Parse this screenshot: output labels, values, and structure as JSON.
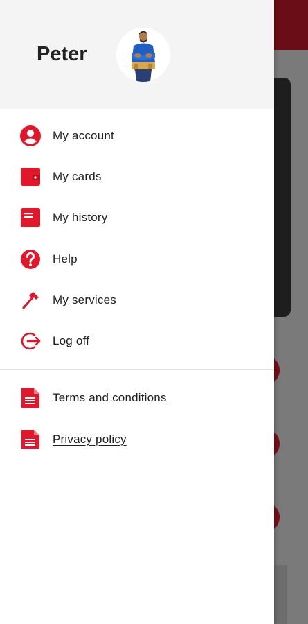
{
  "colors": {
    "accent": "#e3172b",
    "text": "#222222",
    "header_bg": "#f4f4f4",
    "overlay": "#7a7a7a"
  },
  "user": {
    "name": "Peter",
    "avatar_icon": "worker-avatar"
  },
  "menu": [
    {
      "label": "My account",
      "icon": "account-circle-icon"
    },
    {
      "label": "My cards",
      "icon": "wallet-icon"
    },
    {
      "label": "My history",
      "icon": "history-icon"
    },
    {
      "label": "Help",
      "icon": "help-icon"
    },
    {
      "label": "My services",
      "icon": "hammer-icon"
    },
    {
      "label": "Log off",
      "icon": "logout-icon"
    }
  ],
  "links": [
    {
      "label": "Terms and conditions",
      "icon": "document-icon"
    },
    {
      "label": "Privacy policy",
      "icon": "document-icon"
    }
  ]
}
